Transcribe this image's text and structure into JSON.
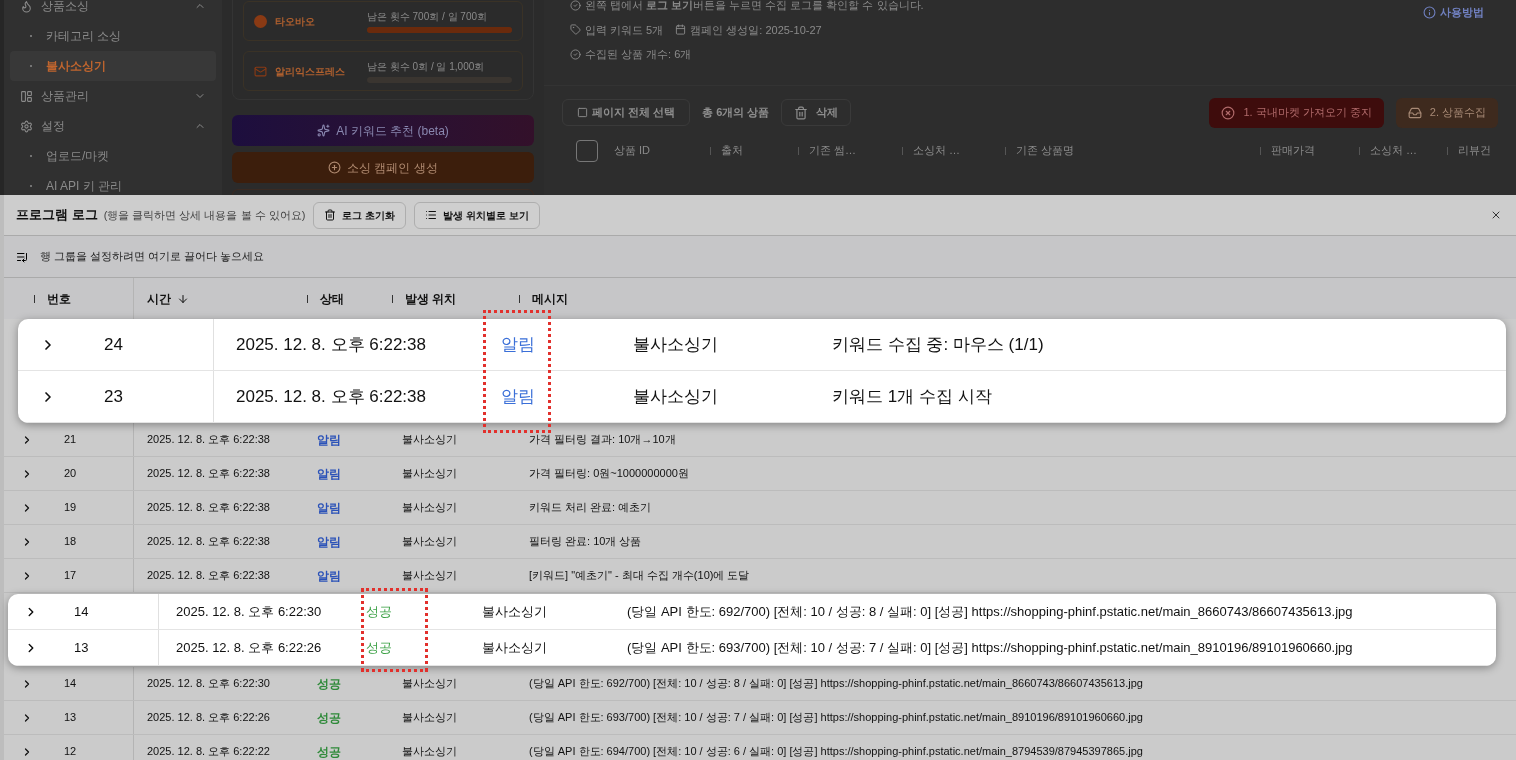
{
  "sidebar": {
    "items": [
      {
        "label": "상품소싱",
        "expanded": true,
        "children": [
          {
            "label": "카테고리 소싱",
            "selected": false
          },
          {
            "label": "불사소싱기",
            "selected": true
          }
        ]
      },
      {
        "label": "상품관리",
        "expanded": false
      },
      {
        "label": "설정",
        "expanded": true,
        "children": [
          {
            "label": "업로드/마켓",
            "selected": false
          },
          {
            "label": "AI API 키 관리",
            "selected": false
          }
        ]
      }
    ]
  },
  "quota_cards": [
    {
      "name": "타오바오",
      "usage": "남은 횟수 700회 / 일 700회",
      "level": 1
    },
    {
      "name": "알리익스프레스",
      "usage": "남은 횟수 0회 / 일 1,000회",
      "level": 0
    }
  ],
  "action_buttons": [
    {
      "label": "AI 키워드 추천 (beta)",
      "kind": "ai"
    },
    {
      "label": "소싱 캠페인 생성",
      "kind": "create"
    }
  ],
  "campaign": {
    "notice": "왼쪽 탭에서 **로그 보기**버튼을 누르면 수집 로그를 확인할 수 있습니다.",
    "keywords": "입력 키워드 5개",
    "created": "캠페인 생성일: 2025-10-27",
    "collected": "수집된 상품 개수: 6개",
    "help_link": "사용방법"
  },
  "toolbar": {
    "select_all": "페이지 전체 선택",
    "checked": false,
    "total": "총 6개의 상품",
    "delete": "삭제",
    "stop": "1. 국내마켓 가져오기 중지",
    "collect": "2. 상품수집"
  },
  "product_table": {
    "header_checked": false,
    "columns": [
      "상품 ID",
      "출처",
      "기존 썸…",
      "소싱처 …",
      "기존 상품명",
      "판매가격",
      "소싱처 …",
      "리뷰건"
    ]
  },
  "log_panel": {
    "title": "프로그램 로그",
    "hint": "(행을 클릭하면 상세 내용을 볼 수 있어요)",
    "buttons": [
      "로그 초기화",
      "발생 위치별로 보기"
    ],
    "group_hint": "행 그룹을 설정하려면 여기로 끌어다 놓으세요",
    "columns": [
      {
        "label": "번호",
        "sorted": false
      },
      {
        "label": "시간",
        "sorted": true
      },
      {
        "label": "상태",
        "sorted": false
      },
      {
        "label": "발생 위치",
        "sorted": false
      },
      {
        "label": "메시지",
        "sorted": false
      }
    ],
    "body": [
      {
        "kind": "callout",
        "rows": [
          {
            "no": "24",
            "time": "2025. 12. 8. 오후 6:22:38",
            "status": {
              "text": "알림",
              "color": "#3a6fd8"
            },
            "source": "불사소싱기",
            "message": "키워드 수집 중: 마우스 (1/1)"
          },
          {
            "no": "23",
            "time": "2025. 12. 8. 오후 6:22:38",
            "status": {
              "text": "알림",
              "color": "#3a6fd8"
            },
            "source": "불사소싱기",
            "message": "키워드 1개 수집 시작"
          }
        ]
      },
      {
        "kind": "row",
        "no": "21",
        "time": "2025. 12. 8. 오후 6:22:38",
        "status": {
          "text": "알림",
          "color": "#2b52b8"
        },
        "source": "불사소싱기",
        "message": "가격 필터링 결과: 10개→10개"
      },
      {
        "kind": "row",
        "no": "20",
        "time": "2025. 12. 8. 오후 6:22:38",
        "status": {
          "text": "알림",
          "color": "#2b52b8"
        },
        "source": "불사소싱기",
        "message": "가격 필터링: 0원~1000000000원"
      },
      {
        "kind": "row",
        "no": "19",
        "time": "2025. 12. 8. 오후 6:22:38",
        "status": {
          "text": "알림",
          "color": "#2b52b8"
        },
        "source": "불사소싱기",
        "message": "키워드 처리 완료: 예초기"
      },
      {
        "kind": "row",
        "no": "18",
        "time": "2025. 12. 8. 오후 6:22:38",
        "status": {
          "text": "알림",
          "color": "#2b52b8"
        },
        "source": "불사소싱기",
        "message": "필터링 완료: 10개 상품"
      },
      {
        "kind": "row",
        "no": "17",
        "time": "2025. 12. 8. 오후 6:22:38",
        "status": {
          "text": "알림",
          "color": "#2b52b8"
        },
        "source": "불사소싱기",
        "message": "[키워드] \"예초기\" - 최대 수집 개수(10)에 도달"
      },
      {
        "kind": "callout",
        "rows": [
          {
            "no": "14",
            "time": "2025. 12. 8. 오후 6:22:30",
            "status": {
              "text": "성공",
              "color": "#3aa044"
            },
            "source": "불사소싱기",
            "message": "(당일 API 한도: 692/700) [전체: 10 / 성공: 8 / 실패: 0] [성공] https://shopping-phinf.pstatic.net/main_8660743/86607435613.jpg"
          },
          {
            "no": "13",
            "time": "2025. 12. 8. 오후 6:22:26",
            "status": {
              "text": "성공",
              "color": "#3aa044"
            },
            "source": "불사소싱기",
            "message": "(당일 API 한도: 693/700) [전체: 10 / 성공: 7 / 실패: 0] [성공] https://shopping-phinf.pstatic.net/main_8910196/89101960660.jpg"
          }
        ]
      },
      {
        "kind": "row",
        "no": "14",
        "time": "2025. 12. 8. 오후 6:22:30",
        "status": {
          "text": "성공",
          "color": "#2f8a3a"
        },
        "source": "불사소싱기",
        "message": "(당일 API 한도: 692/700) [전체: 10 / 성공: 8 / 실패: 0] [성공] https://shopping-phinf.pstatic.net/main_8660743/86607435613.jpg"
      },
      {
        "kind": "row",
        "no": "13",
        "time": "2025. 12. 8. 오후 6:22:26",
        "status": {
          "text": "성공",
          "color": "#2f8a3a"
        },
        "source": "불사소싱기",
        "message": "(당일 API 한도: 693/700) [전체: 10 / 성공: 7 / 실패: 0] [성공] https://shopping-phinf.pstatic.net/main_8910196/89101960660.jpg"
      },
      {
        "kind": "row",
        "no": "12",
        "time": "2025. 12. 8. 오후 6:22:22",
        "status": {
          "text": "성공",
          "color": "#2f8a3a"
        },
        "source": "불사소싱기",
        "message": "(당일 API 한도: 694/700) [전체: 10 / 성공: 6 / 실패: 0] [성공] https://shopping-phinf.pstatic.net/main_8794539/87945397865.jpg"
      }
    ]
  }
}
